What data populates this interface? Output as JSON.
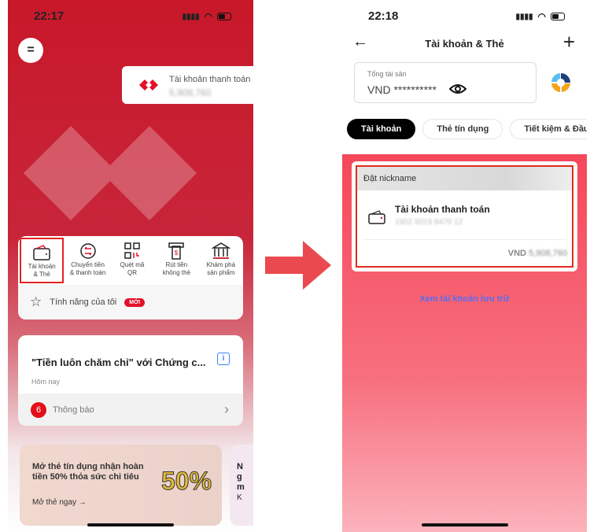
{
  "left_screen": {
    "status_time": "22:17",
    "menu_icon": "menu-icon",
    "account_card": {
      "label": "Tài khoản thanh toán",
      "balance": "5,908,760"
    },
    "quick_actions": [
      {
        "label1": "Tài khoản",
        "label2": "& Thẻ",
        "icon": "wallet-icon",
        "highlighted": true
      },
      {
        "label1": "Chuyển tiền",
        "label2": "& thanh toán",
        "icon": "transfer-icon"
      },
      {
        "label1": "Quét mã",
        "label2": "QR",
        "icon": "qr-icon"
      },
      {
        "label1": "Rút tiền",
        "label2": "không thẻ",
        "icon": "atm-icon"
      },
      {
        "label1": "Khám phá",
        "label2": "sản phẩm",
        "icon": "bank-icon"
      }
    ],
    "favorites": {
      "label": "Tính năng của tôi",
      "badge": "MỚI"
    },
    "notification": {
      "title": "\"Tiền luôn chăm chỉ\" với Chứng c...",
      "date": "Hôm nay",
      "count": "6",
      "footer": "Thông báo"
    },
    "promo": {
      "title": "Mở thẻ tín dụng nhận hoàn tiền 50% thỏa sức chi tiêu",
      "link": "Mở thẻ ngay →",
      "graphic": "50%"
    },
    "promo2": {
      "text": "N\ng\nm",
      "link": "K"
    }
  },
  "right_screen": {
    "status_time": "22:18",
    "title": "Tài khoản & Thẻ",
    "total": {
      "label": "Tổng tài sản",
      "value": "VND **********"
    },
    "tabs": [
      {
        "label": "Tài khoản",
        "active": true
      },
      {
        "label": "Thẻ tín dụng"
      },
      {
        "label": "Tiết kiệm & Đầu tư"
      }
    ],
    "account": {
      "nickname": "Đặt nickname",
      "name": "Tài khoản thanh toán",
      "number": "1902 5019 8470 12",
      "currency": "VND",
      "balance": "5,908,760"
    },
    "archive_link": "Xem tài khoản lưu trữ"
  },
  "colors": {
    "brand_red": "#c8182a",
    "highlight": "#e32a1c",
    "link": "#5a6cf0"
  }
}
